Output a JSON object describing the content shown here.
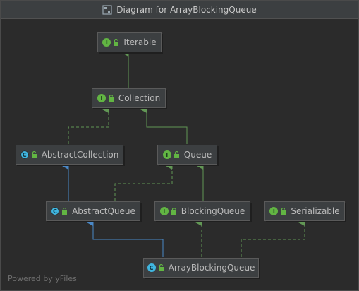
{
  "window": {
    "title": "Diagram for ArrayBlockingQueue"
  },
  "nodes": {
    "iterable": {
      "label": "Iterable",
      "kind": "interface",
      "badge": "I"
    },
    "collection": {
      "label": "Collection",
      "kind": "interface",
      "badge": "I"
    },
    "abstract_collection": {
      "label": "AbstractCollection",
      "kind": "abstract-class",
      "badge": "C"
    },
    "queue": {
      "label": "Queue",
      "kind": "interface",
      "badge": "I"
    },
    "abstract_queue": {
      "label": "AbstractQueue",
      "kind": "abstract-class",
      "badge": "C"
    },
    "blocking_queue": {
      "label": "BlockingQueue",
      "kind": "interface",
      "badge": "I"
    },
    "serializable": {
      "label": "Serializable",
      "kind": "interface",
      "badge": "I"
    },
    "array_blocking_queue": {
      "label": "ArrayBlockingQueue",
      "kind": "class",
      "badge": "C"
    }
  },
  "colors": {
    "extends_interface": "#629755",
    "extends_class": "#4a88c7",
    "implements": "#629755"
  },
  "footer": {
    "text": "Powered by yFiles"
  }
}
